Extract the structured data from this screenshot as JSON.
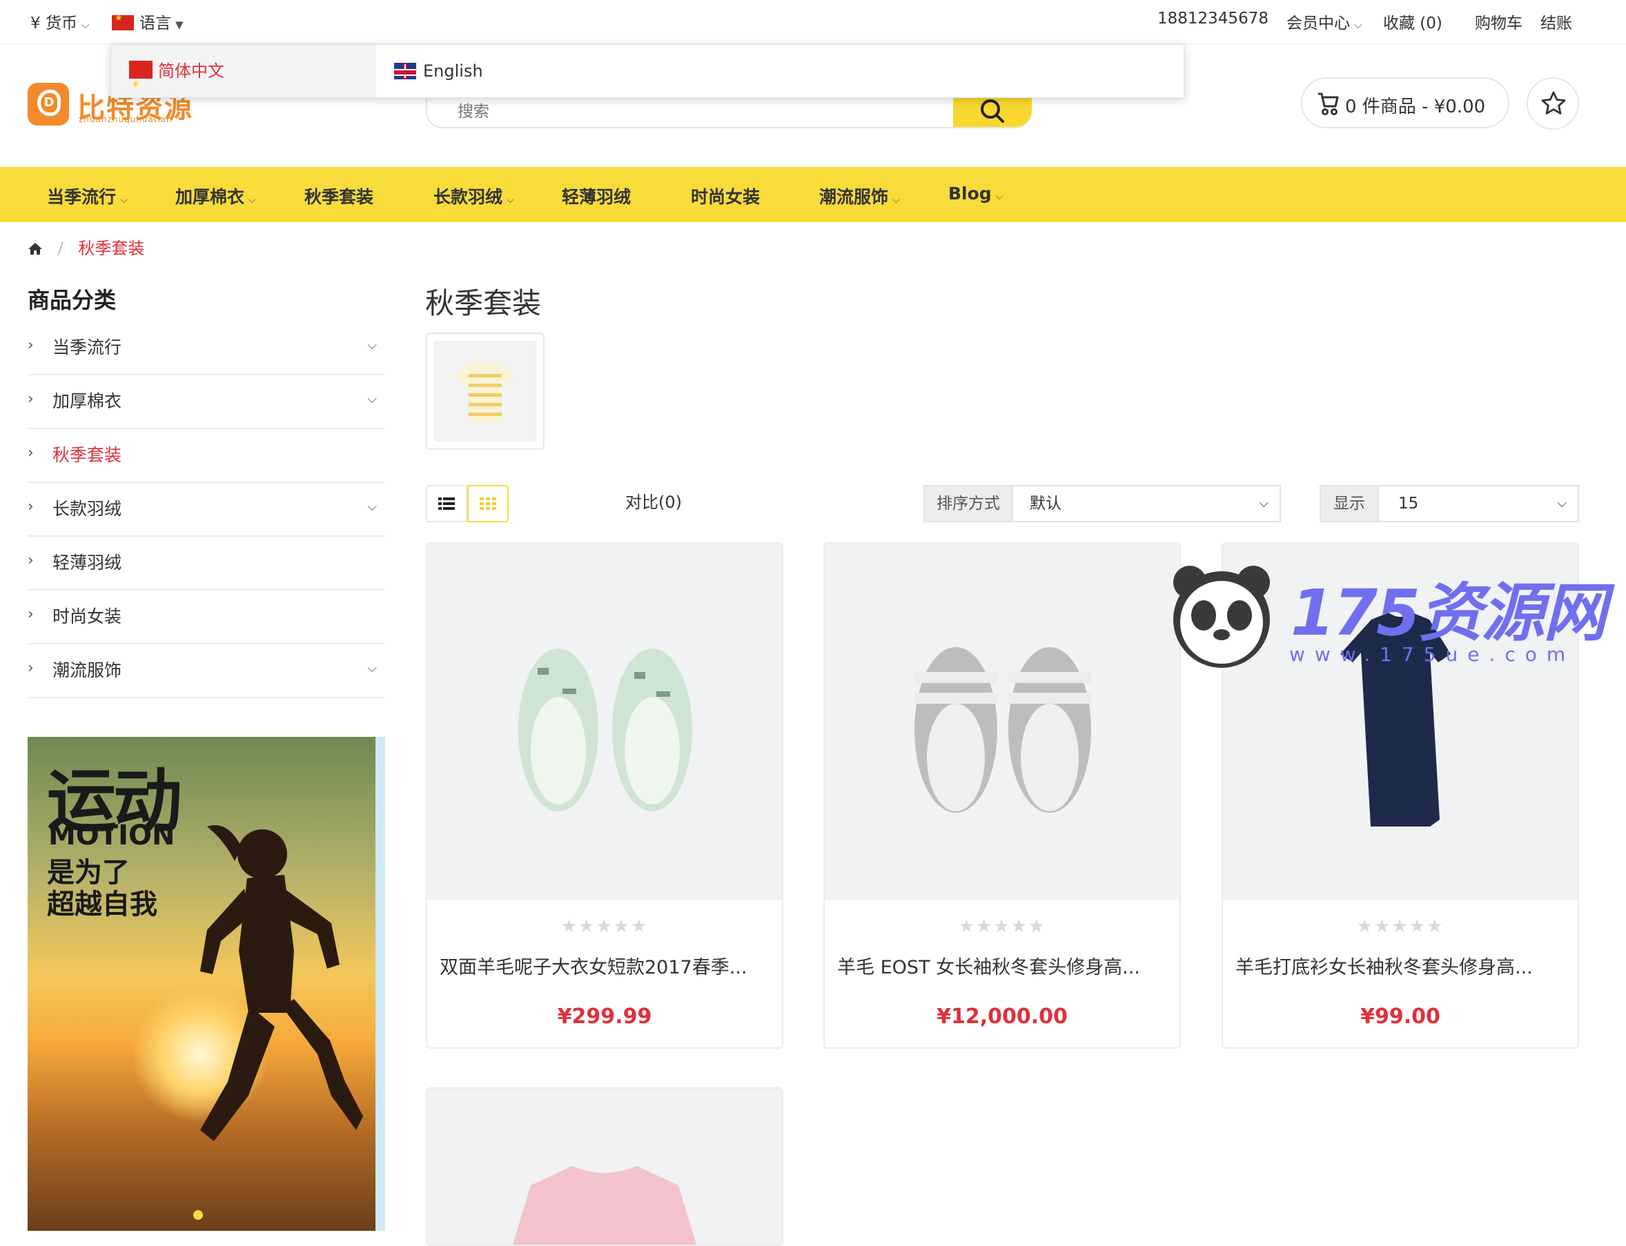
{
  "topbar": {
    "currency_label": "¥ 货币",
    "language_label": "语言",
    "phone": "18812345678",
    "account_label": "会员中心",
    "wishlist_label": "收藏 (0)",
    "cart_label": "购物车",
    "checkout_label": "结账"
  },
  "language_dropdown": {
    "options": [
      "简体中文",
      "English"
    ],
    "selected": "简体中文"
  },
  "logo": {
    "text": "比特资源",
    "subtext": "zhuanzhuquhuatian"
  },
  "search": {
    "placeholder": "搜索"
  },
  "cart": {
    "summary": "0 件商品 - ¥0.00"
  },
  "nav": {
    "items": [
      {
        "label": "当季流行",
        "has_dropdown": true
      },
      {
        "label": "加厚棉衣",
        "has_dropdown": true
      },
      {
        "label": "秋季套装",
        "has_dropdown": false
      },
      {
        "label": "长款羽绒",
        "has_dropdown": true
      },
      {
        "label": "轻薄羽绒",
        "has_dropdown": false
      },
      {
        "label": "时尚女装",
        "has_dropdown": false
      },
      {
        "label": "潮流服饰",
        "has_dropdown": true
      },
      {
        "label": "Blog",
        "has_dropdown": true
      }
    ]
  },
  "breadcrumb": {
    "current": "秋季套装"
  },
  "sidebar": {
    "title": "商品分类",
    "items": [
      {
        "label": "当季流行",
        "expandable": true,
        "active": false
      },
      {
        "label": "加厚棉衣",
        "expandable": true,
        "active": false
      },
      {
        "label": "秋季套装",
        "expandable": false,
        "active": true
      },
      {
        "label": "长款羽绒",
        "expandable": true,
        "active": false
      },
      {
        "label": "轻薄羽绒",
        "expandable": false,
        "active": false
      },
      {
        "label": "时尚女装",
        "expandable": false,
        "active": false
      },
      {
        "label": "潮流服饰",
        "expandable": true,
        "active": false
      }
    ],
    "banner": {
      "line1": "运动",
      "line2": "MOTION",
      "line3": "是为了",
      "line4": "超越自我"
    }
  },
  "main": {
    "title": "秋季套装",
    "compare_label": "对比(0)",
    "sort_label": "排序方式",
    "sort_value": "默认",
    "show_label": "显示",
    "show_value": "15",
    "products": [
      {
        "name": "双面羊毛呢子大衣女短款2017春季...",
        "price": "¥299.99",
        "rating": 0
      },
      {
        "name": "羊毛 EOST 女长袖秋冬套头修身高...",
        "price": "¥12,000.00",
        "rating": 0
      },
      {
        "name": "羊毛打底衫女长袖秋冬套头修身高...",
        "price": "¥99.00",
        "rating": 0
      }
    ]
  },
  "watermark": {
    "text": "175资源网",
    "url": "www.175ue.com"
  },
  "colors": {
    "accent": "#f8dc3a",
    "price": "#e0303a",
    "brand": "#f28a2b"
  }
}
